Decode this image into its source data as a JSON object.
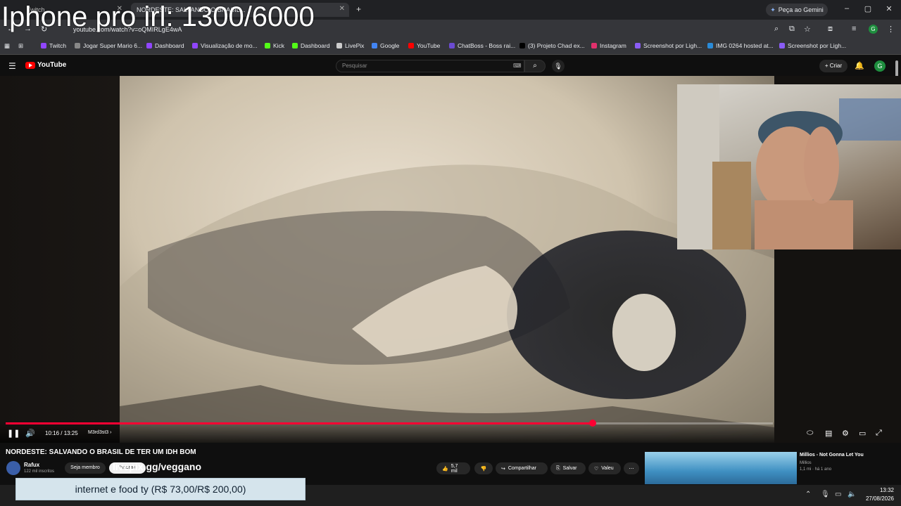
{
  "stream_overlay": {
    "title": "Iphone pro irl: 1300/6000",
    "donation": "internet e food ty (R$ 73,00/R$ 200,00)",
    "link": "livepix.gg/veggano"
  },
  "browser": {
    "tabs": [
      {
        "label": "Twitch"
      },
      {
        "label": "NORDESTE: SALVANDO O BRASIL..."
      }
    ],
    "gemini_button": "Peça ao Gemini",
    "url": "youtube.com/watch?v=oQMIRLgE4wA",
    "bookmarks": [
      {
        "label": "Twitch",
        "color": "#9146ff"
      },
      {
        "label": "Jogar Super Mario 6...",
        "color": "#888888"
      },
      {
        "label": "Dashboard",
        "color": "#9146ff"
      },
      {
        "label": "Visualização de mo...",
        "color": "#9146ff"
      },
      {
        "label": "Kick",
        "color": "#53fc18"
      },
      {
        "label": "Dashboard",
        "color": "#53fc18"
      },
      {
        "label": "LivePix",
        "color": "#cccccc"
      },
      {
        "label": "Google",
        "color": "#4285f4"
      },
      {
        "label": "YouTube",
        "color": "#ff0000"
      },
      {
        "label": "ChatBoss - Boss rai...",
        "color": "#6b4bd1"
      },
      {
        "label": "(3) Projeto Chad ex...",
        "color": "#000000"
      },
      {
        "label": "Instagram",
        "color": "#e1306c"
      },
      {
        "label": "Screenshot por Ligh...",
        "color": "#8a5cf5"
      },
      {
        "label": "IMG 0264 hosted at...",
        "color": "#2a8bd8"
      },
      {
        "label": "Screenshot por Ligh...",
        "color": "#8a5cf5"
      }
    ]
  },
  "youtube": {
    "logo": "YouTube",
    "search_placeholder": "Pesquisar",
    "create_label": "Criar",
    "avatar_letter": "G",
    "player": {
      "time": "10:16 / 13:25",
      "chapter": "M3rd3st3",
      "progress": 0.765
    },
    "video_title": "NORDESTE: SALVANDO O BRASIL DE TER UM IDH BOM",
    "channel": {
      "name": "Rafux",
      "subs": "122 mil inscritos",
      "join": "Seja membro",
      "subscribe": "Inscrito"
    },
    "actions": {
      "likes": "5,7 mil",
      "share": "Compartilhar",
      "save": "Salvar",
      "thanks": "Valeu"
    },
    "recommended": {
      "title": "Millios - Not Gonna Let You",
      "channel": "Millios",
      "meta": "1,1 mi · há 1 ano"
    }
  },
  "taskbar": {
    "time": "13:32",
    "date": "27/08/2026"
  }
}
